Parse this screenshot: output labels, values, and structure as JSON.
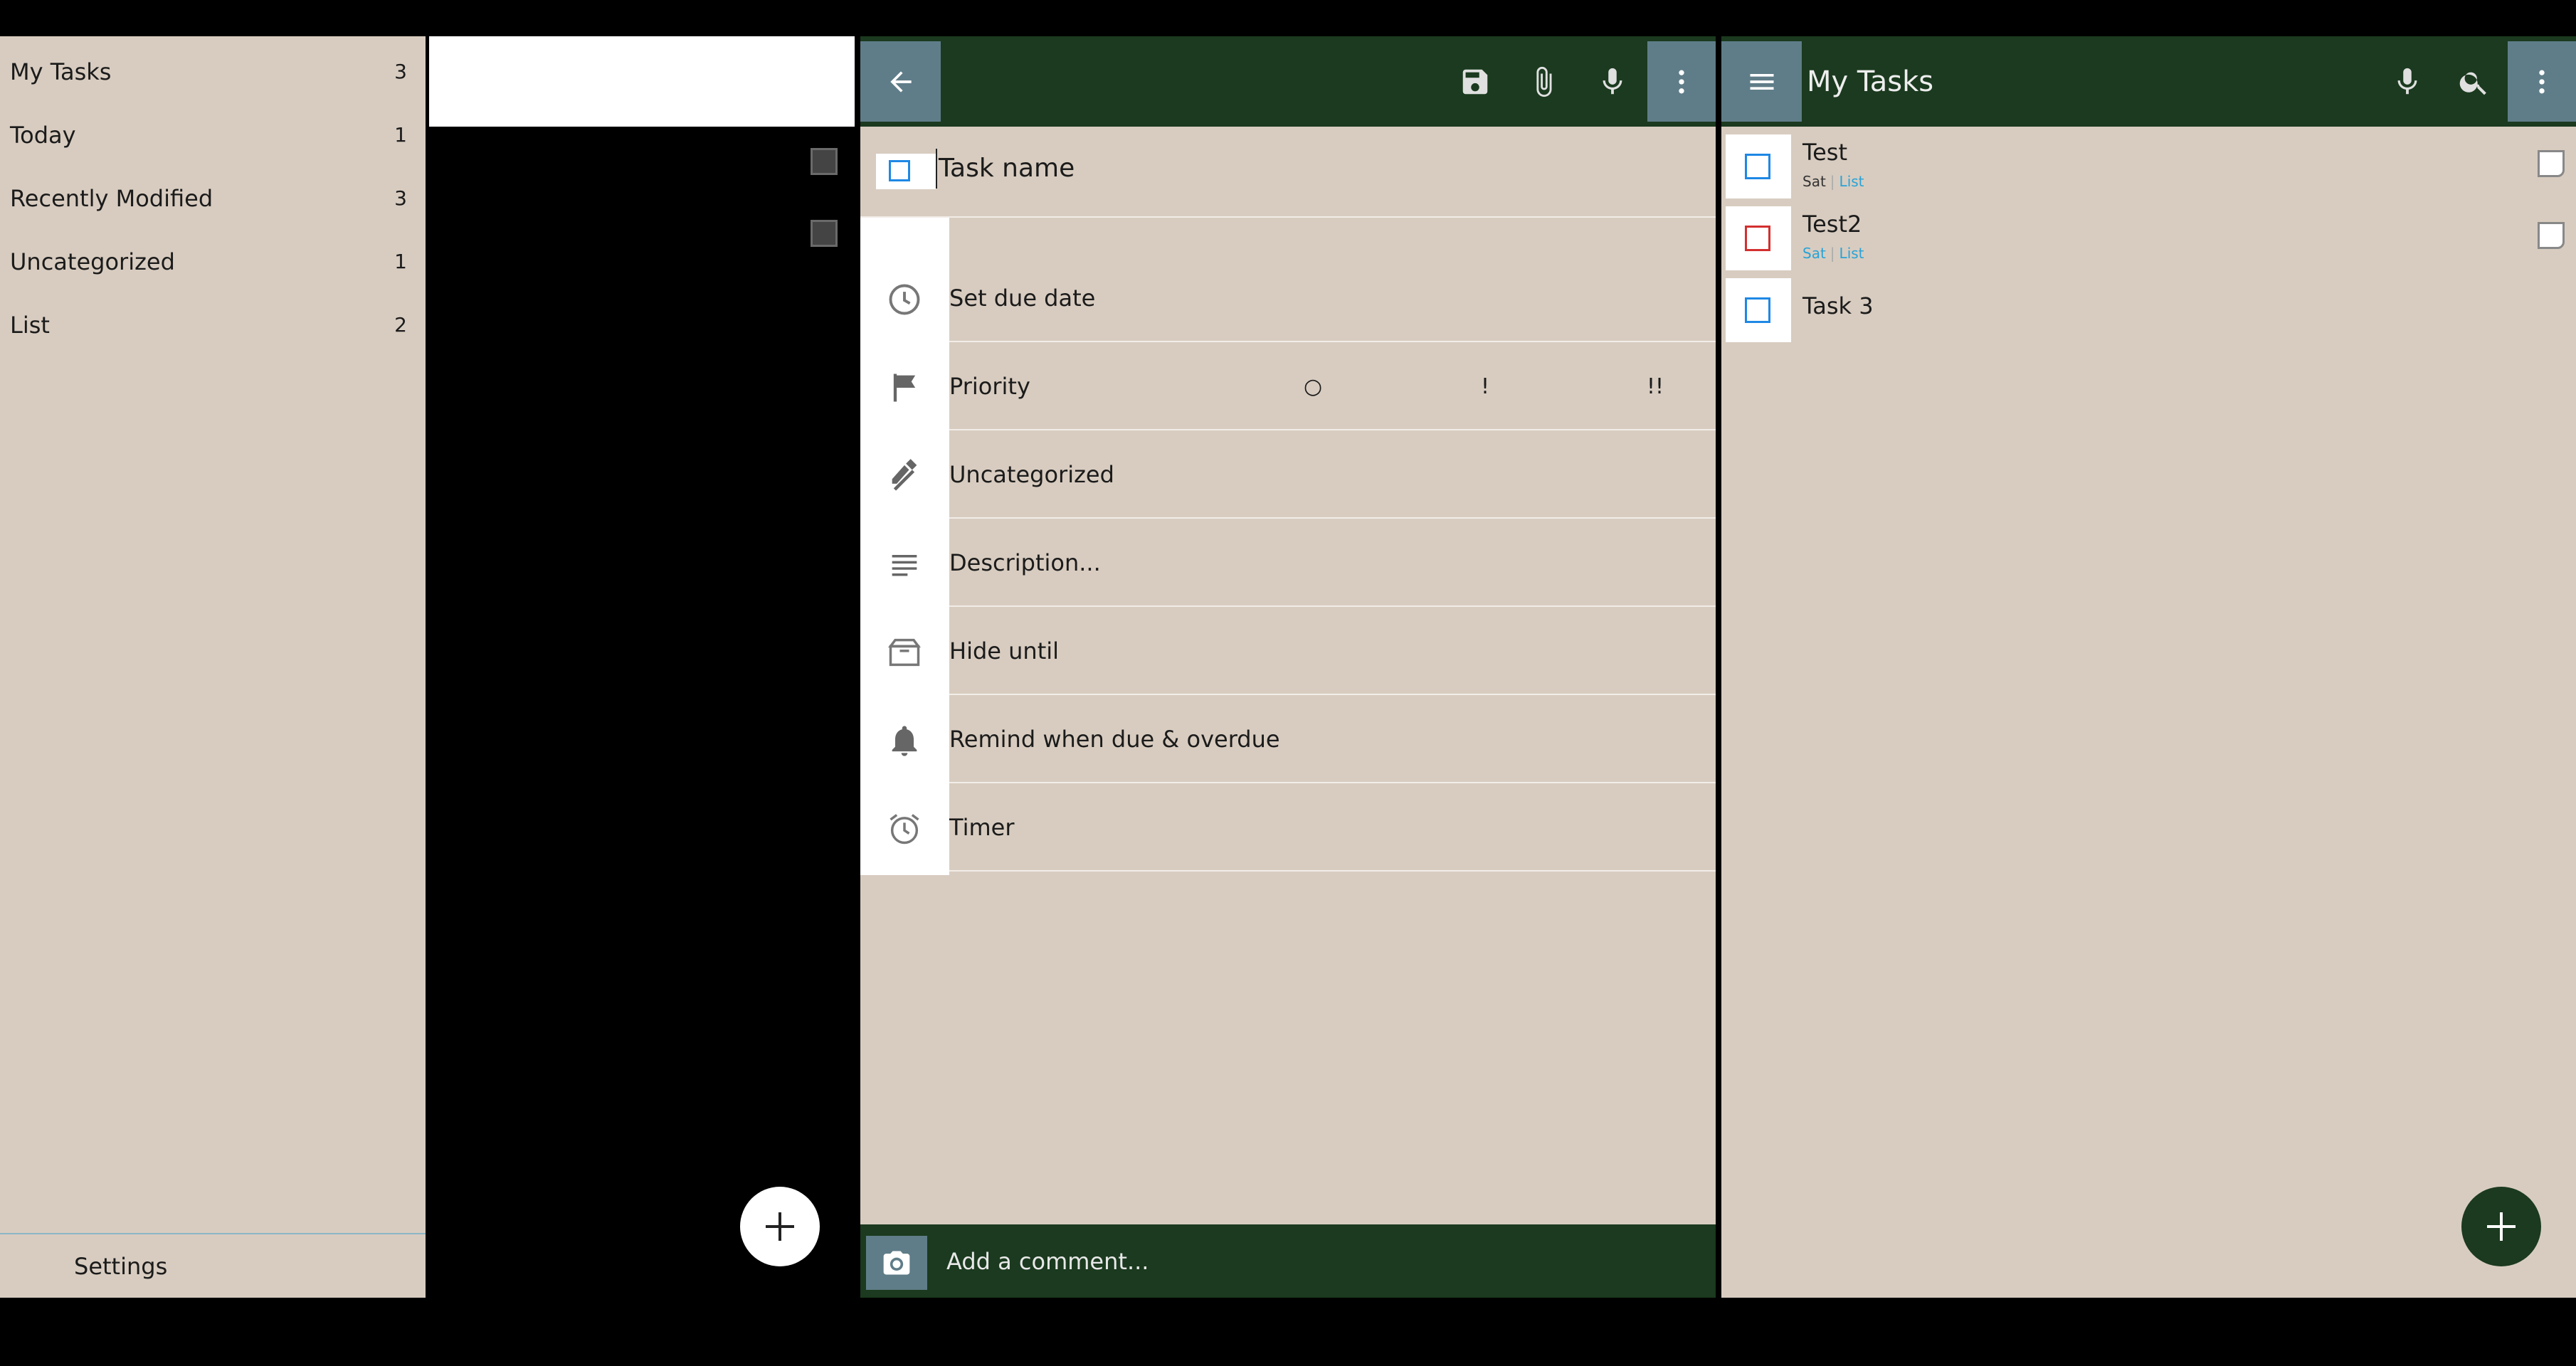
{
  "nav": {
    "items": [
      {
        "label": "My Tasks",
        "count": "3"
      },
      {
        "label": "Today",
        "count": "1"
      },
      {
        "label": "Recently Modified",
        "count": "3"
      },
      {
        "label": "Uncategorized",
        "count": "1"
      },
      {
        "label": "List",
        "count": "2"
      }
    ],
    "settings_label": "Settings"
  },
  "editor": {
    "task_name": "Task name",
    "rows": {
      "due_date": "Set due date",
      "priority": "Priority",
      "category": "Uncategorized",
      "description": "Description...",
      "hide_until": "Hide until",
      "remind": "Remind when due & overdue",
      "timer": "Timer"
    },
    "priority_levels": [
      "○",
      "!",
      "!!",
      "!!!"
    ],
    "comment_placeholder": "Add a comment..."
  },
  "list": {
    "title": "My Tasks",
    "tasks": [
      {
        "title": "Test",
        "day": "Sat",
        "tag": "List",
        "checkbox_color": "#1e88e5"
      },
      {
        "title": "Test2",
        "day": "Sat",
        "tag": "List",
        "checkbox_color": "#d32f2f"
      },
      {
        "title": "Task 3",
        "checkbox_color": "#1e88e5"
      }
    ]
  },
  "colors": {
    "toolbar": "#1b3a1f",
    "background": "#d8ccc0",
    "action_button": "#5f7d88",
    "link": "#29a3d6"
  }
}
